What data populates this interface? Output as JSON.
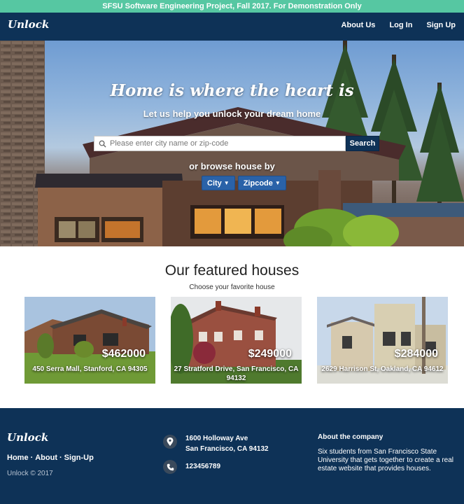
{
  "banner": {
    "text": "SFSU Software Engineering Project, Fall 2017. For Demonstration Only"
  },
  "navbar": {
    "brand": "Unlock",
    "links": [
      "About Us",
      "Log In",
      "Sign Up"
    ]
  },
  "hero": {
    "title": "Home is where the heart is",
    "subtitle": "Let us help you unlock your dream home",
    "search": {
      "placeholder": "Please enter city name or zip-code",
      "value": "",
      "button": "Search"
    },
    "browse_label": "or browse house by",
    "browse_buttons": [
      "City",
      "Zipcode"
    ]
  },
  "featured": {
    "title": "Our featured houses",
    "subtitle": "Choose your favorite house",
    "houses": [
      {
        "price": "$462000",
        "address": "450 Serra Mall, Stanford, CA 94305"
      },
      {
        "price": "$249000",
        "address": "27 Stratford Drive, San Francisco, CA 94132"
      },
      {
        "price": "$284000",
        "address": "2629 Harrison St, Oakland, CA 94612"
      }
    ]
  },
  "footer": {
    "brand": "Unlock",
    "links": [
      "Home",
      "About",
      "Sign-Up"
    ],
    "separator": "·",
    "copyright": "Unlock © 2017",
    "address_line1": "1600 Holloway Ave",
    "address_line2": "San Francisco, CA 94132",
    "phone": "123456789",
    "about_heading": "About the company",
    "about_text": "Six students from San Francisco State University that gets together to create a real estate website that provides houses."
  },
  "icons": {
    "search": "search-icon",
    "location": "map-pin-icon",
    "phone": "phone-icon"
  },
  "colors": {
    "banner": "#56c7a2",
    "navy": "#0e3257",
    "button_blue": "#2a62a8"
  }
}
